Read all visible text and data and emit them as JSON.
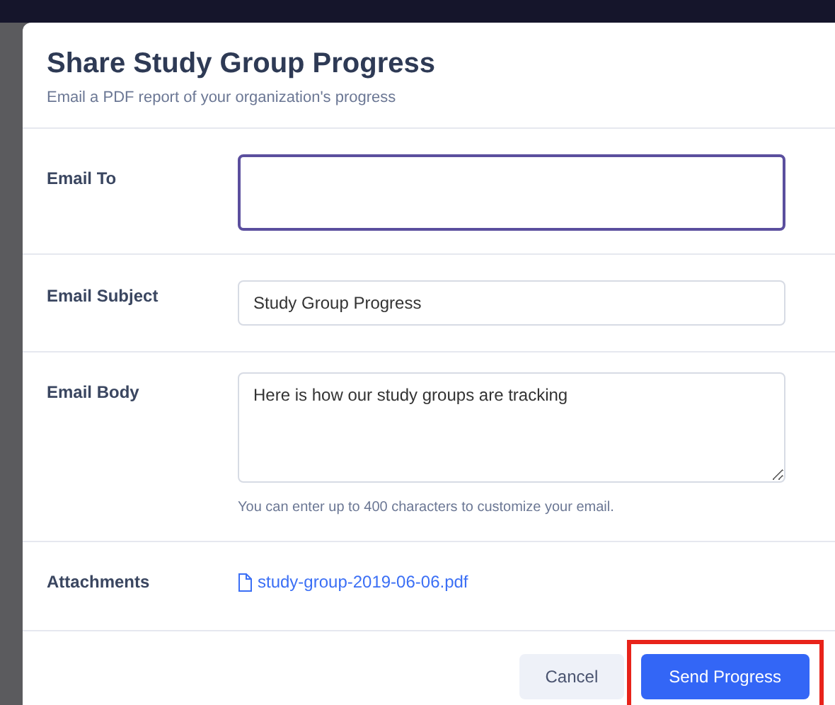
{
  "dialog": {
    "title": "Share Study Group Progress",
    "subtitle": "Email a PDF report of your organization's progress"
  },
  "fields": [
    {
      "kind": "input",
      "label": "Email To",
      "focused": true
    },
    {
      "kind": "input",
      "label": "Email Subject",
      "value": "Study Group Progress",
      "focused": false
    },
    {
      "kind": "textarea",
      "label": "Email Body",
      "value": "Here is how our study groups are tracking",
      "hint": "You can enter up to 400 characters to customize your email.",
      "focused": false
    },
    {
      "kind": "attachment",
      "label": "Attachments",
      "value": "study-group-2019-06-06.pdf"
    }
  ],
  "buttons": [
    {
      "label": "Cancel",
      "kind": "secondary",
      "highlighted": false
    },
    {
      "label": "Send Progress",
      "kind": "primary",
      "highlighted": true
    }
  ]
}
